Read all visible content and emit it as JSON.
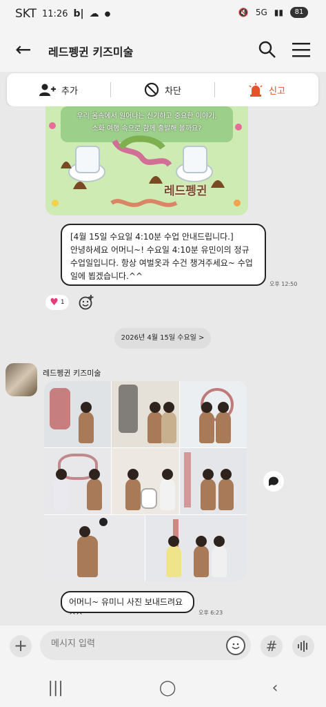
{
  "status": {
    "carrier": "SKT",
    "time": "11:26",
    "icons": [
      "b-icon",
      "cloud-icon",
      "dot-icon"
    ],
    "battery": "81",
    "signal": "5G"
  },
  "header": {
    "title": "레드펭귄 키즈미술"
  },
  "actions": {
    "add": "추가",
    "block": "차단",
    "report": "신고"
  },
  "poster": {
    "caption_line1": "우리 몸속에서 일어나는 신기하고 중요한 이야기,",
    "caption_line2": "소화 여행 속으로 함께 출발해 볼까요?",
    "brand": "레드펭귄"
  },
  "messages": [
    {
      "text": "[4월 15일 수요일 4:10분 수업 안내드립니다.]\n안녕하세요 어머니~! 수요일 4:10분 유민이의 정규수업일입니다. 항상 여벌옷과 수건 챙겨주세요~ 수업일에 뵙겠습니다.^^",
      "time": "오후 12:50"
    },
    {
      "text": "어머니~ 유미니 사진 보내드려요 ^^",
      "time": "오후 6:23"
    }
  ],
  "reaction": {
    "count": "1"
  },
  "date_divider": "2026년 4월 15일 수요일 >",
  "sender": {
    "name": "레드펭귄 키즈미술"
  },
  "input": {
    "placeholder": "메시지 입력"
  },
  "colors": {
    "accent": "#e5532b",
    "bubble_border": "#222222",
    "bg": "#e9e9e9"
  }
}
